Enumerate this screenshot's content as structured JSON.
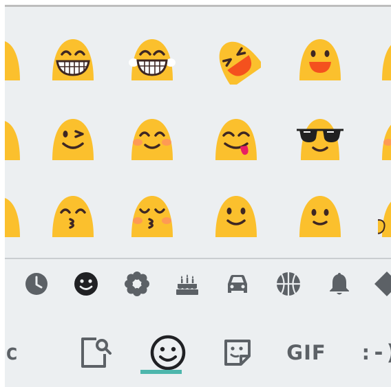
{
  "emoji_grid": {
    "rows": [
      [
        "grinning-face-with-smiling-eyes-partial",
        "grinning-face-with-smiling-eyes",
        "face-with-tears-of-joy",
        "rolling-on-the-floor-laughing",
        "smiling-face-with-open-mouth",
        "partial-next"
      ],
      [
        "smiling-face-partial",
        "winking-face",
        "smiling-face-with-smiling-eyes",
        "face-savoring-food",
        "smiling-face-with-sunglasses",
        "partial-next"
      ],
      [
        "kissing-face-partial",
        "kissing-face-with-smiling-eyes",
        "kissing-face-with-closed-eyes",
        "slightly-smiling-face",
        "slightly-smiling-face-2",
        "partial-next"
      ]
    ],
    "colors": {
      "face": "#fbc02d",
      "face_shade": "#f9a825",
      "features": "#3e2723",
      "mouth": "#f4511e",
      "blush": "#ff8a65",
      "tongue": "#e91e63",
      "tears": "#64b5f6"
    }
  },
  "category_bar": {
    "items": [
      {
        "name": "recent-icon",
        "selected": false
      },
      {
        "name": "smileys-icon",
        "selected": true
      },
      {
        "name": "nature-icon",
        "selected": false
      },
      {
        "name": "food-icon",
        "selected": false
      },
      {
        "name": "travel-icon",
        "selected": false
      },
      {
        "name": "activity-icon",
        "selected": false
      },
      {
        "name": "objects-icon",
        "selected": false
      },
      {
        "name": "symbols-icon",
        "selected": false
      }
    ],
    "icon_color": "#5c6166",
    "selected_color": "#202124"
  },
  "bottom_bar": {
    "partial_label": "c",
    "gif_label": "GIF",
    "emoticon_label": ":-)",
    "active_tab": "emoji",
    "indicator_color": "#4db6ac"
  }
}
